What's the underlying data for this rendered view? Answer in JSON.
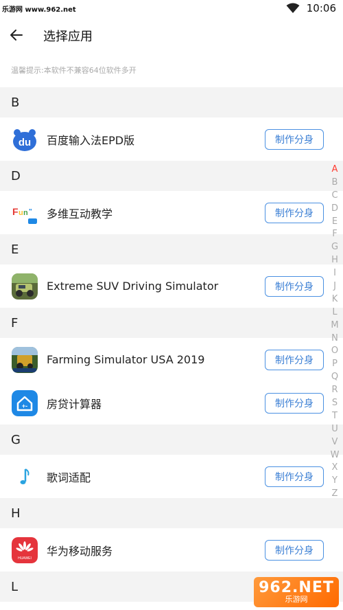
{
  "watermark": "乐游网 www.962.net",
  "status": {
    "time": "10:06"
  },
  "appbar": {
    "title": "选择应用"
  },
  "hint": "温馨提示:本软件不兼容64位软件多开",
  "button_label": "制作分身",
  "sections": [
    {
      "letter": "B",
      "apps": [
        {
          "name": "百度输入法EPD版",
          "icon": "baidu-input-icon"
        }
      ]
    },
    {
      "letter": "D",
      "apps": [
        {
          "name": "多维互动教学",
          "icon": "fun-icon"
        }
      ]
    },
    {
      "letter": "E",
      "apps": [
        {
          "name": "Extreme SUV Driving Simulator",
          "icon": "suv-icon"
        }
      ]
    },
    {
      "letter": "F",
      "apps": [
        {
          "name": "Farming Simulator USA 2019",
          "icon": "farming-icon"
        },
        {
          "name": "房贷计算器",
          "icon": "mortgage-icon"
        }
      ]
    },
    {
      "letter": "G",
      "apps": [
        {
          "name": "歌词适配",
          "icon": "music-note-icon"
        }
      ]
    },
    {
      "letter": "H",
      "apps": [
        {
          "name": "华为移动服务",
          "icon": "huawei-icon"
        }
      ]
    },
    {
      "letter": "L",
      "apps": []
    }
  ],
  "index_letters": [
    "A",
    "B",
    "C",
    "D",
    "E",
    "F",
    "G",
    "H",
    "I",
    "J",
    "K",
    "L",
    "M",
    "N",
    "O",
    "P",
    "Q",
    "R",
    "S",
    "T",
    "U",
    "V",
    "W",
    "X",
    "Y",
    "Z"
  ],
  "index_active": "A",
  "corner_logo": {
    "big": "962.NET",
    "small": "乐游网"
  },
  "colors": {
    "accent": "#4a90e2",
    "index_active": "#ff3b30",
    "section_bg": "#f3f3f3"
  }
}
